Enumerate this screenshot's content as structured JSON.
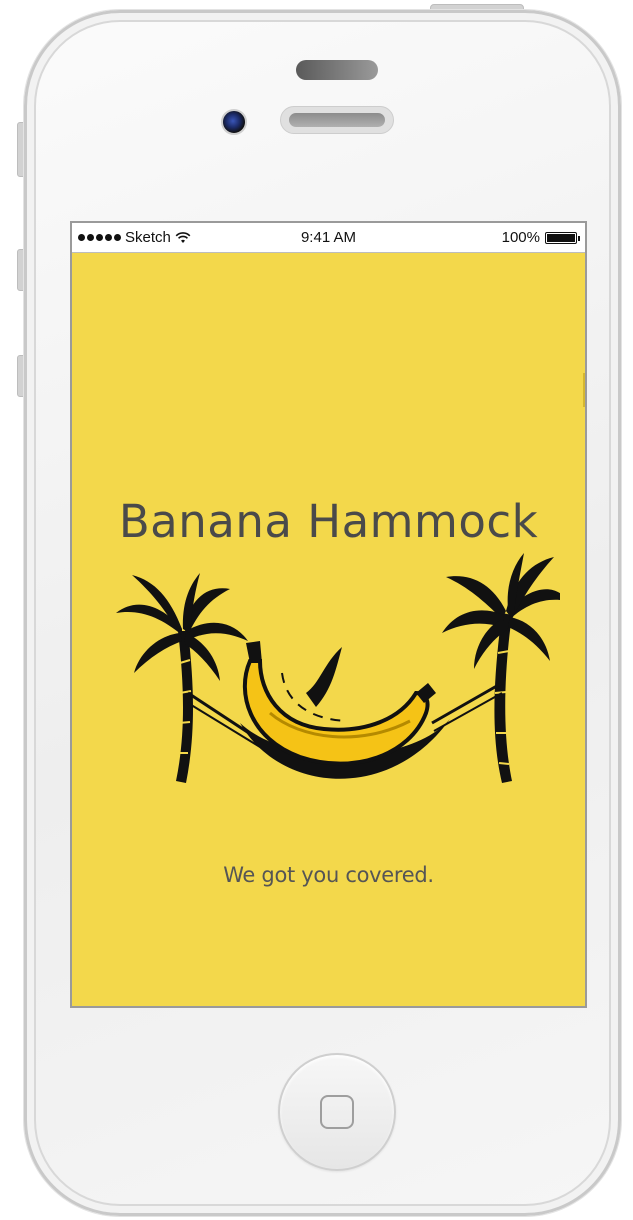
{
  "status_bar": {
    "carrier": "Sketch",
    "time": "9:41 AM",
    "battery": "100%",
    "signal_icon": "signal-dots-icon",
    "wifi_icon": "wifi-icon",
    "battery_icon": "battery-icon"
  },
  "splash": {
    "title": "Banana Hammock",
    "tagline": "We got you covered.",
    "illustration_icon": "banana-hammock-palm-trees-icon"
  },
  "colors": {
    "screen_background": "#f3d84b",
    "title_text": "#4a4a4a",
    "banana": "#f5c316",
    "ink": "#111111"
  },
  "device": {
    "camera_icon": "front-camera-icon",
    "speaker_icon": "earpiece-speaker-icon",
    "home_icon": "home-button-icon"
  }
}
